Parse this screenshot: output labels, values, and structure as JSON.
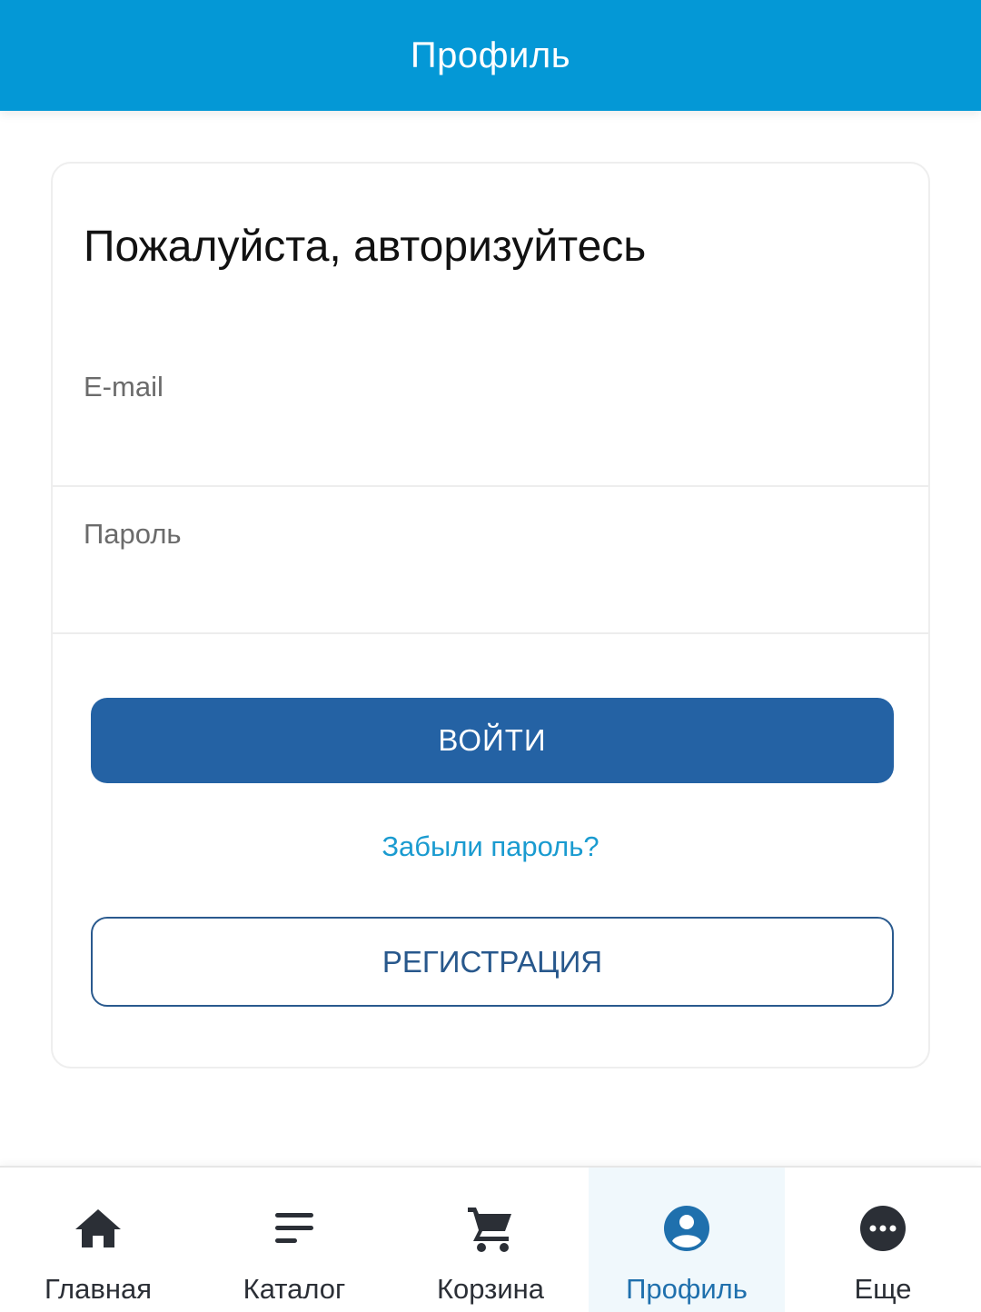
{
  "header": {
    "title": "Профиль"
  },
  "login": {
    "heading": "Пожалуйста, авторизуйтесь",
    "email_label": "E-mail",
    "email_value": "",
    "password_label": "Пароль",
    "password_value": "",
    "submit_label": "ВОЙТИ",
    "forgot_label": "Забыли пароль?",
    "register_label": "РЕГИСТРАЦИЯ"
  },
  "bottom_nav": {
    "active_index": 3,
    "items": [
      {
        "label": "Главная",
        "icon": "home-icon"
      },
      {
        "label": "Каталог",
        "icon": "menu-lines-icon"
      },
      {
        "label": "Корзина",
        "icon": "cart-icon"
      },
      {
        "label": "Профиль",
        "icon": "user-circle-icon"
      },
      {
        "label": "Еще",
        "icon": "more-dots-icon"
      }
    ]
  },
  "colors": {
    "header_bg": "#0498d6",
    "primary_button": "#2462a4",
    "link": "#1a9bd0",
    "active_nav": "#1f70ad",
    "nav_icon": "#2b2f36"
  }
}
